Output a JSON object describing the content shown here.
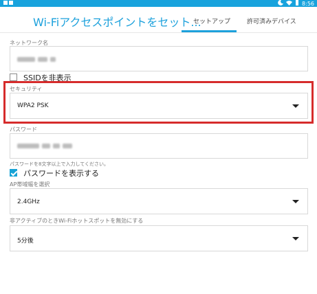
{
  "status_bar": {
    "left_icons": "notifications-icon",
    "time": "8:56",
    "right_icons": [
      "moon-icon",
      "wifi-icon",
      "battery-icon"
    ]
  },
  "appbar": {
    "title": "Wi-Fiアクセスポイントをセット...",
    "tabs": [
      {
        "label": "セットアップ",
        "active": true
      },
      {
        "label": "許可済みデバイス",
        "active": false
      }
    ]
  },
  "form": {
    "network_name": {
      "label": "ネットワーク名",
      "value_obscured": true
    },
    "hide_ssid": {
      "label": "SSIDを非表示",
      "checked": false
    },
    "security": {
      "label": "セキュリティ",
      "value": "WPA2 PSK",
      "highlighted": true
    },
    "password": {
      "label": "パスワード",
      "value_obscured": true,
      "hint": "パスワードを8文字以上で入力してください。"
    },
    "show_password": {
      "label": "パスワードを表示する",
      "checked": true
    },
    "ap_band": {
      "label": "AP帯域幅を選択",
      "value": "2.4GHz"
    },
    "inactive_disable": {
      "label": "非アクティブのときWi-Fiホットスポットを無効にする",
      "value": "5分後"
    }
  },
  "colors": {
    "accent": "#1da1dc",
    "status_bar": "#18a3dd",
    "highlight_border": "#d62b2b",
    "checkbox_checked": "#17a3d6"
  }
}
